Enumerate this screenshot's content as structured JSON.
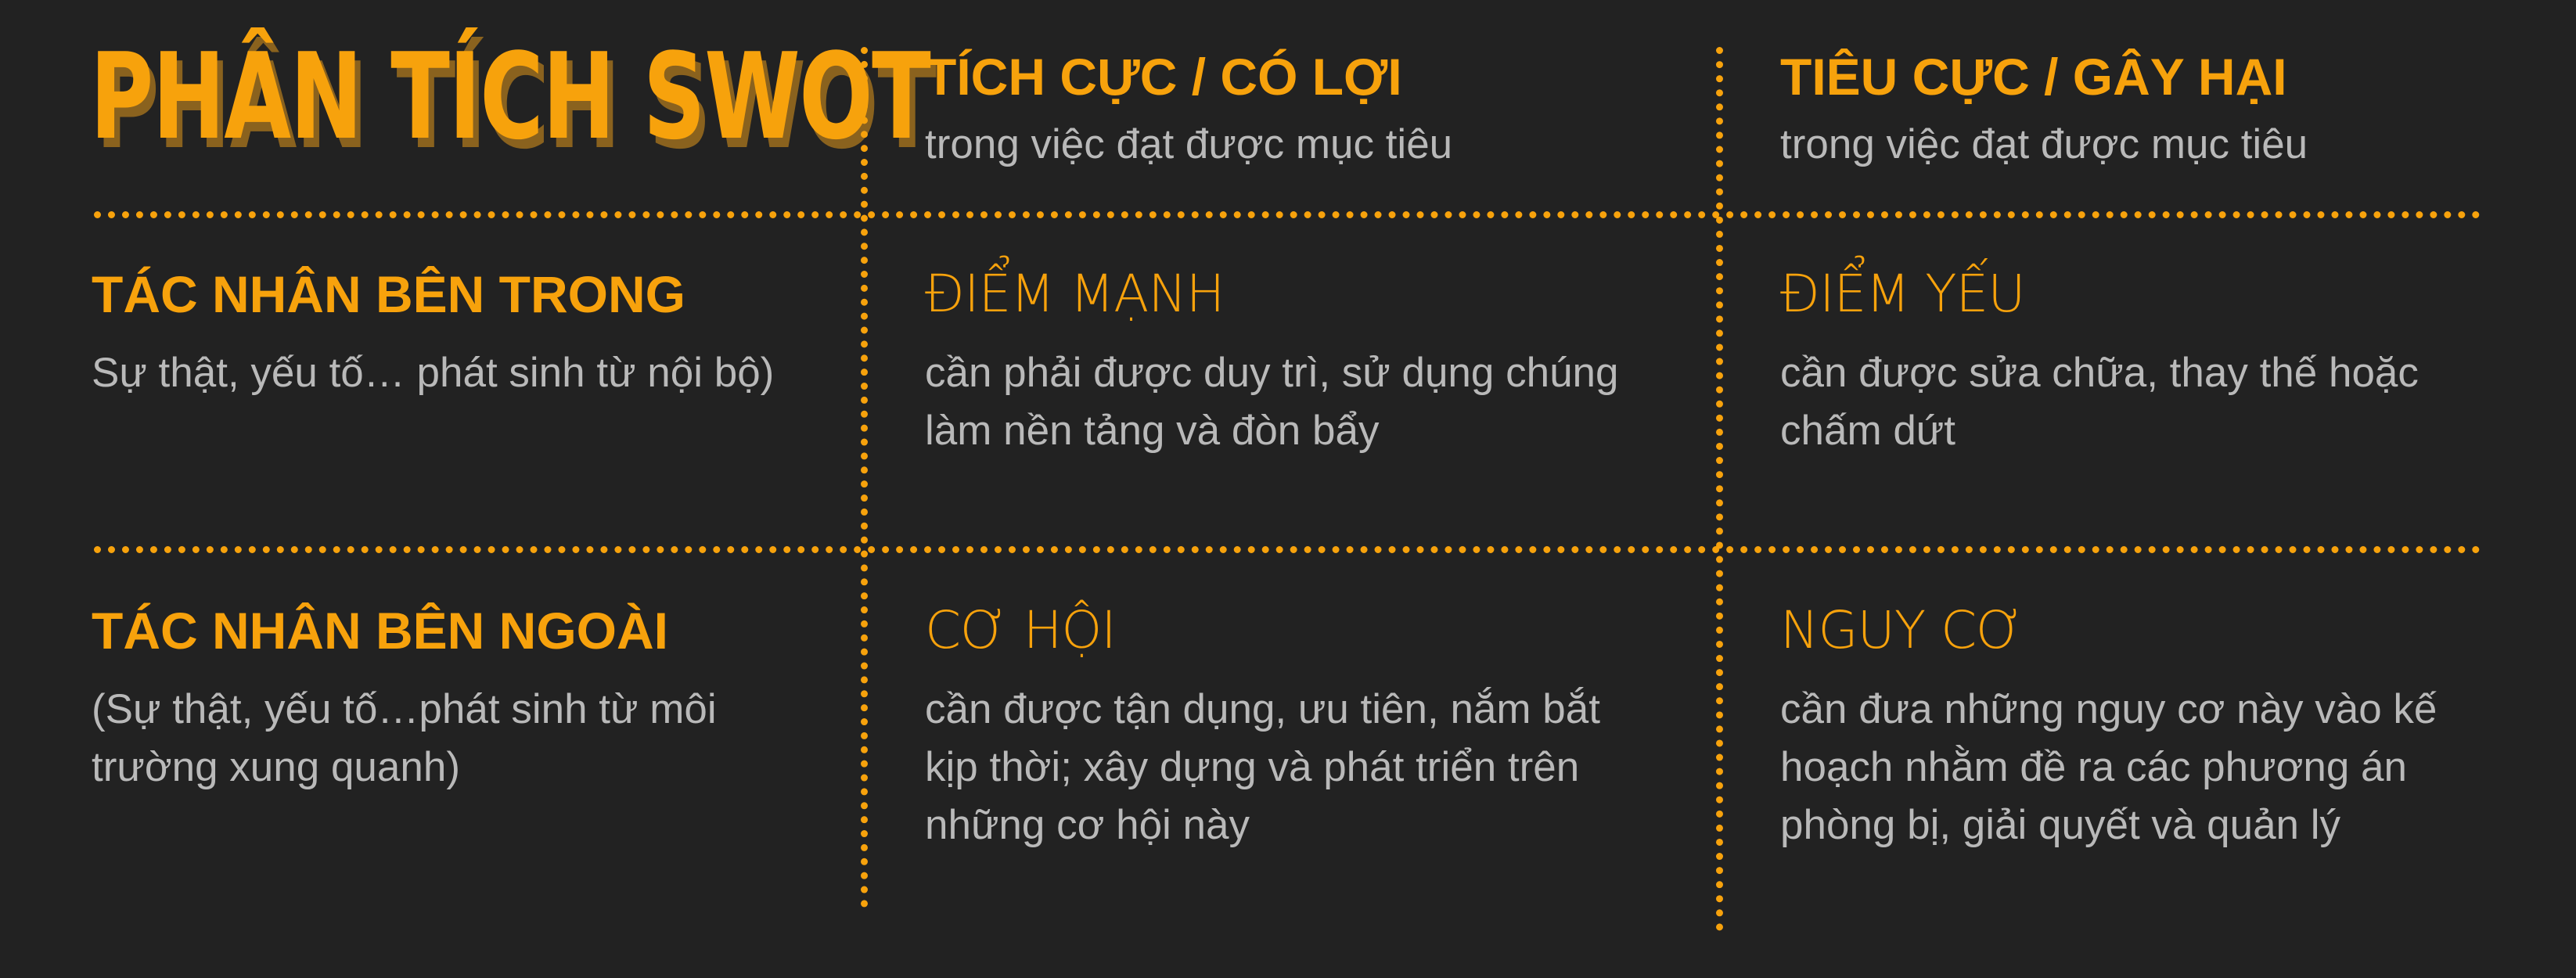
{
  "title": "PHÂN TÍCH SWOT",
  "columns": {
    "positive": {
      "heading": "TÍCH CỰC / CÓ LỢI",
      "sub": "trong việc đạt được mục tiêu"
    },
    "negative": {
      "heading": "TIÊU CỰC / GÂY HẠI",
      "sub": "trong việc đạt được mục tiêu"
    }
  },
  "rows": {
    "internal": {
      "heading": "TÁC NHÂN BÊN TRONG",
      "sub": "Sự thật, yếu tố… phát sinh từ nội bộ)"
    },
    "external": {
      "heading": "TÁC NHÂN BÊN NGOÀI",
      "sub": "(Sự thật, yếu tố…phát sinh từ môi trường xung quanh)"
    }
  },
  "cells": {
    "strengths": {
      "title": "ĐIỂM MẠNH",
      "desc": "cần phải được duy trì, sử dụng chúng làm nền tảng và đòn bẩy"
    },
    "weaknesses": {
      "title": "ĐIỂM YẾU",
      "desc": "cần được sửa chữa, thay thế hoặc chấm dứt"
    },
    "opportunities": {
      "title": "CƠ HỘI",
      "desc": "cần được tận dụng, ưu tiên, nắm bắt kịp thời; xây dựng và phát triển trên những cơ hội này"
    },
    "threats": {
      "title": "NGUY CƠ",
      "desc": "cần đưa những nguy cơ này vào kế hoạch nhằm đề ra các phương án phòng bị, giải quyết và quản lý"
    }
  },
  "colors": {
    "background": "#222222",
    "accent": "#F7A20C",
    "accent_shadow": "#8A621E",
    "text": "#B9B9B9"
  }
}
